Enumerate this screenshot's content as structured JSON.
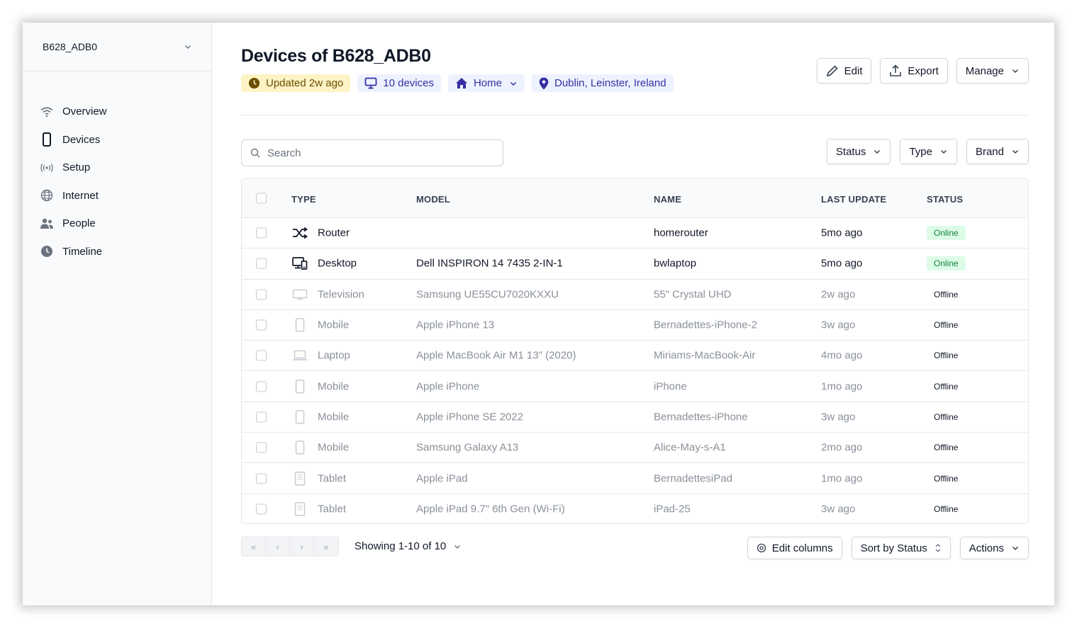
{
  "sidebar": {
    "org_name": "B628_ADB0",
    "items": [
      {
        "label": "Overview",
        "icon": "wifi-icon"
      },
      {
        "label": "Devices",
        "icon": "phone-icon"
      },
      {
        "label": "Setup",
        "icon": "broadcast-icon"
      },
      {
        "label": "Internet",
        "icon": "globe-icon"
      },
      {
        "label": "People",
        "icon": "people-icon"
      },
      {
        "label": "Timeline",
        "icon": "clock-icon"
      }
    ]
  },
  "header": {
    "title": "Devices of B628_ADB0",
    "chips": {
      "updated": "Updated 2w ago",
      "devices": "10 devices",
      "location_type": "Home",
      "address": "Dublin, Leinster, Ireland"
    },
    "actions": {
      "edit": "Edit",
      "export": "Export",
      "manage": "Manage"
    }
  },
  "search": {
    "placeholder": "Search"
  },
  "filters": {
    "status": "Status",
    "type": "Type",
    "brand": "Brand"
  },
  "table": {
    "columns": {
      "type": "TYPE",
      "model": "MODEL",
      "name": "NAME",
      "last_update": "LAST UPDATE",
      "status": "STATUS"
    },
    "rows": [
      {
        "type": "Router",
        "model": "",
        "name": "homerouter",
        "last_update": "5mo ago",
        "status": "Online"
      },
      {
        "type": "Desktop",
        "model": "Dell INSPIRON 14 7435 2-IN-1",
        "name": "bwlaptop",
        "last_update": "5mo ago",
        "status": "Online"
      },
      {
        "type": "Television",
        "model": "Samsung UE55CU7020KXXU",
        "name": "55\" Crystal UHD",
        "last_update": "2w ago",
        "status": "Offline"
      },
      {
        "type": "Mobile",
        "model": "Apple iPhone 13",
        "name": "Bernadettes-iPhone-2",
        "last_update": "3w ago",
        "status": "Offline"
      },
      {
        "type": "Laptop",
        "model": "Apple MacBook Air M1 13\" (2020)",
        "name": "Miriams-MacBook-Air",
        "last_update": "4mo ago",
        "status": "Offline"
      },
      {
        "type": "Mobile",
        "model": "Apple iPhone",
        "name": "iPhone",
        "last_update": "1mo ago",
        "status": "Offline"
      },
      {
        "type": "Mobile",
        "model": "Apple iPhone SE 2022",
        "name": "Bernadettes-iPhone",
        "last_update": "3w ago",
        "status": "Offline"
      },
      {
        "type": "Mobile",
        "model": "Samsung Galaxy A13",
        "name": "Alice-May-s-A1",
        "last_update": "2mo ago",
        "status": "Offline"
      },
      {
        "type": "Tablet",
        "model": "Apple iPad",
        "name": "BernadettesiPad",
        "last_update": "1mo ago",
        "status": "Offline"
      },
      {
        "type": "Tablet",
        "model": "Apple iPad 9.7\" 6th Gen (Wi-Fi)",
        "name": "iPad-25",
        "last_update": "3w ago",
        "status": "Offline"
      }
    ]
  },
  "footer": {
    "pager": {
      "first": "«",
      "prev": "‹",
      "next": "›",
      "last": "»"
    },
    "showing": "Showing 1-10 of 10",
    "edit_columns": "Edit columns",
    "sort": "Sort by Status",
    "actions": "Actions"
  },
  "colors": {
    "online_bg": "#dcfce7",
    "online_text": "#15803d",
    "updated_chip": "#fdf3c4",
    "info_chip": "#eef2ff"
  }
}
